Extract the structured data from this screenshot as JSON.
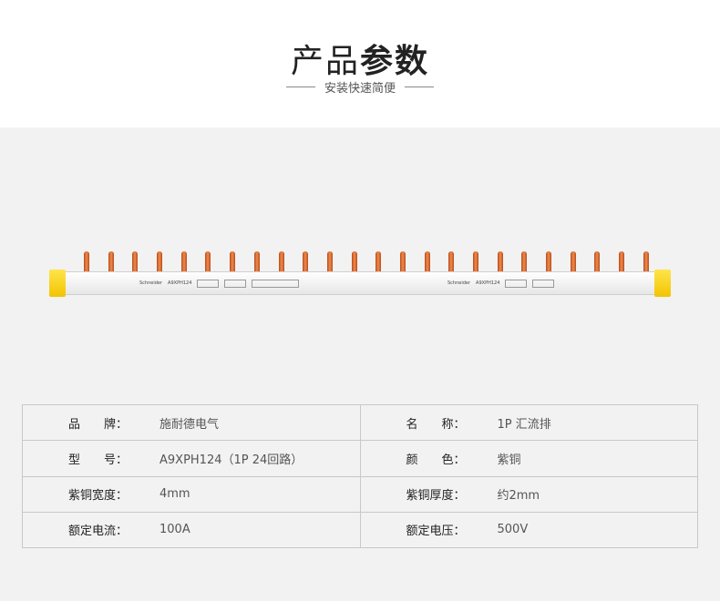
{
  "header": {
    "title_light": "产品",
    "title_bold": "参数",
    "subtitle": "安装快速简便"
  },
  "product": {
    "brand_print": "Schneider",
    "model_print": "A9XPH124",
    "tooth_count": 24
  },
  "specs": [
    [
      {
        "label": "品　　牌：",
        "value": "施耐德电气"
      },
      {
        "label": "名　　称：",
        "value": "1P 汇流排"
      }
    ],
    [
      {
        "label": "型　　号：",
        "value": "A9XPH124（1P 24回路）"
      },
      {
        "label": "颜　　色：",
        "value": "紫铜"
      }
    ],
    [
      {
        "label": "紫铜宽度：",
        "value": "4mm"
      },
      {
        "label": "紫铜厚度：",
        "value": "约2mm"
      }
    ],
    [
      {
        "label": "额定电流：",
        "value": "100A"
      },
      {
        "label": "额定电压：",
        "value": "500V"
      }
    ]
  ]
}
